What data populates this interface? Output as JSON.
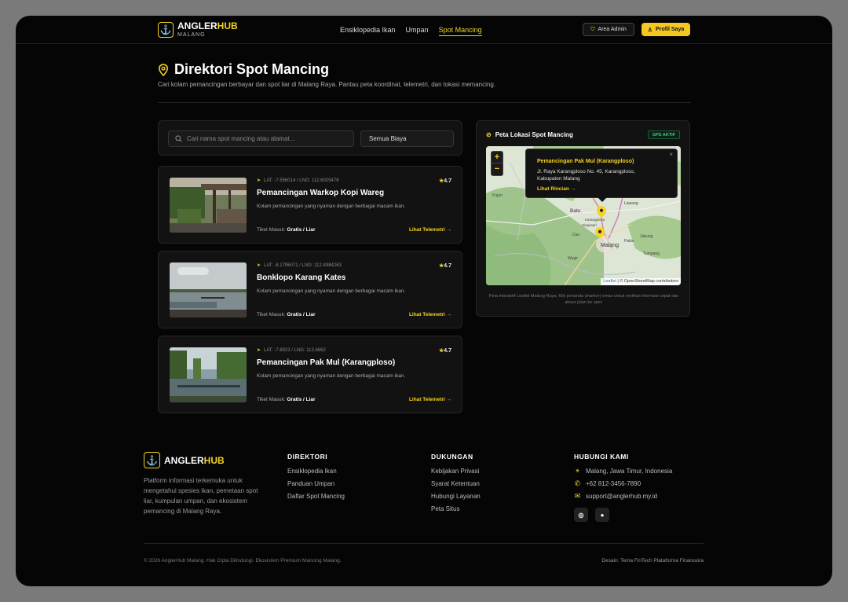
{
  "header": {
    "logo_main_a": "ANGLER",
    "logo_main_b": "HUB",
    "logo_sub": "MALANG",
    "nav": [
      "Ensiklopedia Ikan",
      "Umpan",
      "Spot Mancing"
    ],
    "admin_label": "Area Admin",
    "profile_label": "Profil Saya"
  },
  "page": {
    "title": "Direktori Spot Mancing",
    "subtitle": "Cari kolam pemancingan berbayar dan spot liar di Malang Raya. Pantau peta koordinat, telemetri, dan lokasi memancing."
  },
  "search": {
    "placeholder": "Cari nama spot mancing atau alamat...",
    "filter_value": "Semua Biaya"
  },
  "spots": [
    {
      "coord": "LAT: -7.556014 / LNG: 112.6025476",
      "rating": "4.7",
      "name": "Pemancingan Warkop Kopi Wareg",
      "desc": "Kolam pemancingan yang nyaman dengan berbagai macam ikan.",
      "tiket_label": "Tiket Masuk:",
      "tiket_value": "Gratis / Liar",
      "link": "Lihat Telemetri →"
    },
    {
      "coord": "LAT: -8.1796071 / LNG: 112.4984263",
      "rating": "4.7",
      "name": "Bonklopo Karang Kates",
      "desc": "Kolam pemancingan yang nyaman dengan berbagai macam ikan.",
      "tiket_label": "Tiket Masuk:",
      "tiket_value": "Gratis / Liar",
      "link": "Lihat Telemetri →"
    },
    {
      "coord": "LAT: -7.8923 / LNG: 112.6662",
      "rating": "4.7",
      "name": "Pemancingan Pak Mul (Karangploso)",
      "desc": "Kolam pemancingan yang nyaman dengan berbagai macam ikan.",
      "tiket_label": "Tiket Masuk:",
      "tiket_value": "Gratis / Liar",
      "link": "Lihat Telemetri →"
    }
  ],
  "map": {
    "title": "Peta Lokasi Spot Mancing",
    "badge": "GPS AKTIF",
    "zoom_in": "+",
    "zoom_out": "−",
    "popup_title": "Pemancingan Pak Mul (Karangploso)",
    "popup_address": "Jl. Raya Karangploso No. 45, Karangploso, Kabupaten Malang",
    "popup_link": "Lihat Rincian →",
    "popup_close": "×",
    "attribution_leaflet": "Leaflet",
    "attribution_osm": "| © OpenStreetMap contributors",
    "labels": [
      "Batu",
      "Karangploso",
      "Singosari",
      "Lawang",
      "Jabung",
      "Malang",
      "Tumpang",
      "Pakis",
      "Wagir",
      "Dau",
      "Pujon"
    ],
    "footnote": "Peta interaktif Leaflet Malang Raya. Klik penanda (marker) emas untuk melihat informasi cepat dan akses jalan ke spot."
  },
  "footer": {
    "logo_main_a": "ANGLER",
    "logo_main_b": "HUB",
    "description": "Platform informasi terkemuka untuk mengetahui spesies ikan, pemetaan spot liar, kumpulan umpan, dan ekosistem pemancing di Malang Raya.",
    "col1_title": "DIREKTORI",
    "col1": [
      "Ensiklopedia Ikan",
      "Panduan Umpan",
      "Daftar Spot Mancing"
    ],
    "col2_title": "DUKUNGAN",
    "col2": [
      "Kebijakan Privasi",
      "Syarat Ketentuan",
      "Hubungi Layanan",
      "Peta Situs"
    ],
    "col3_title": "HUBUNGI KAMI",
    "contact_location": "Malang, Jawa Timur, Indonesia",
    "contact_phone": "+62 812-3456-7890",
    "contact_email": "support@anglerhub.my.id",
    "copyright": "© 2026 AnglerHub Malang. Hak Cipta Dilindungi. Ekosistem Premium Mancing Malang.",
    "credit": "Desain: Tema FinTech Plataforma Financeira"
  },
  "colors": {
    "accent": "#f5d321",
    "background": "#050505",
    "card": "#121212",
    "gps_green": "#3fcf7b"
  }
}
